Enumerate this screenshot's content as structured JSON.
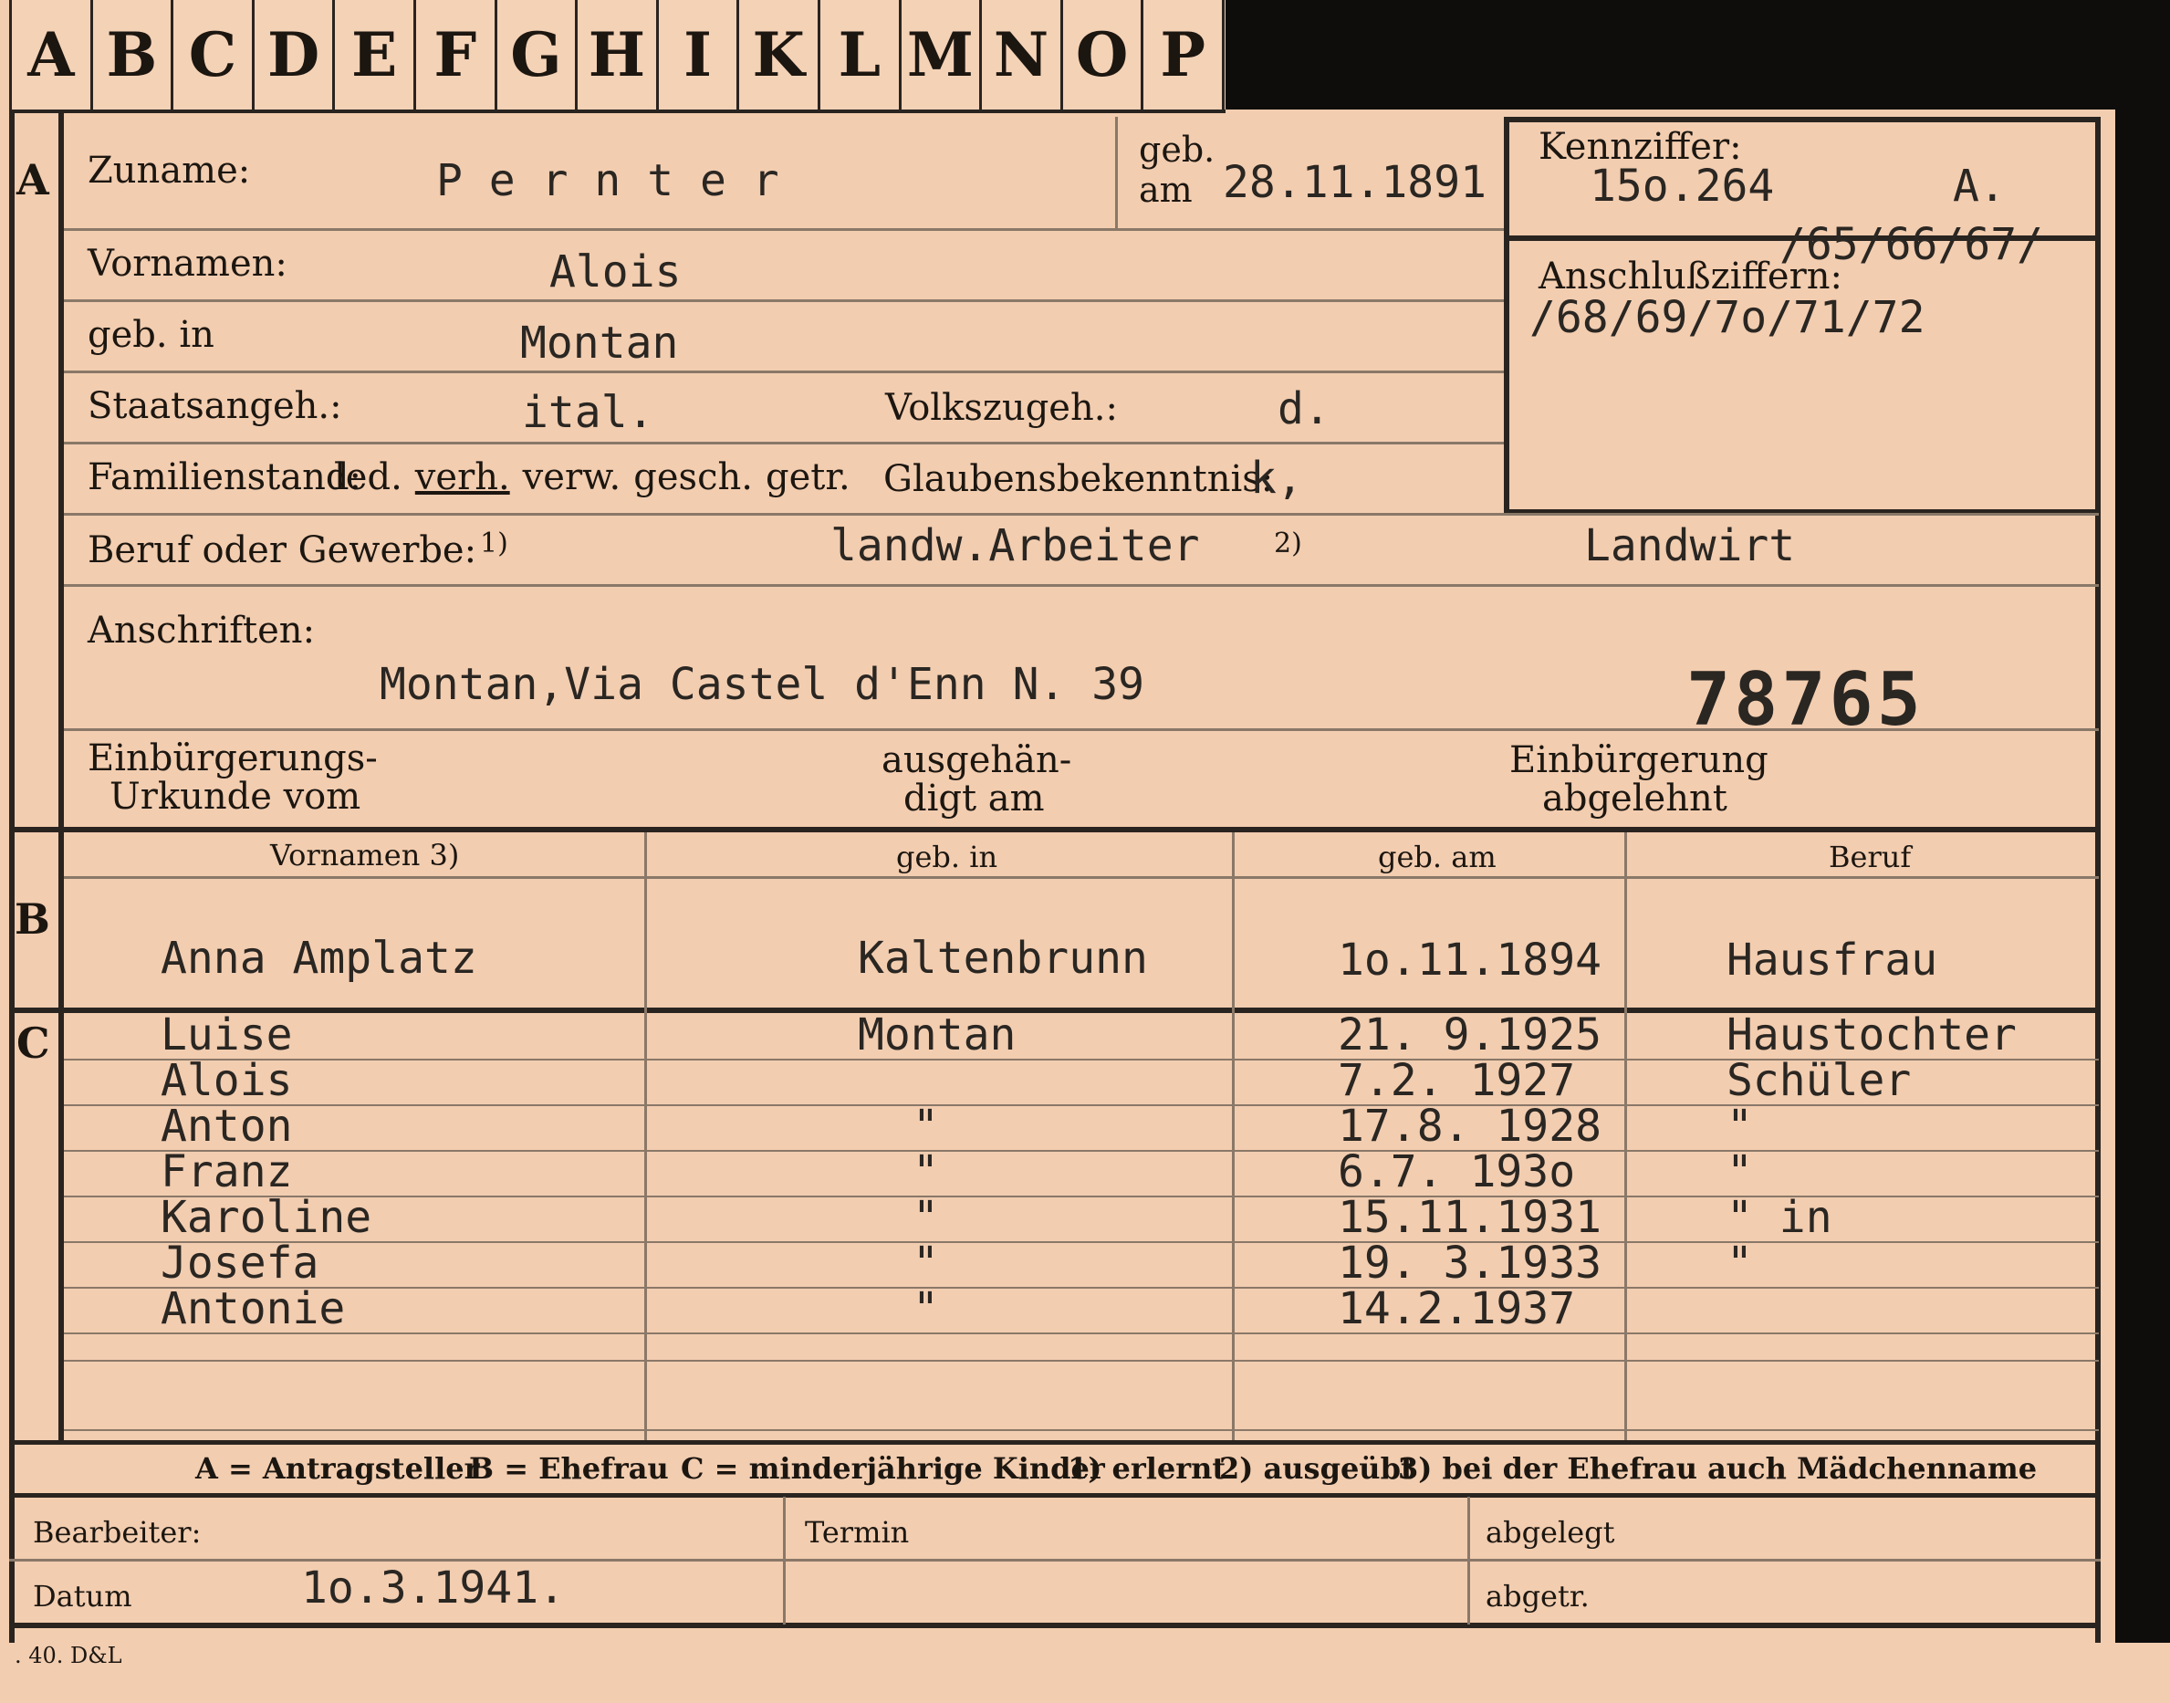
{
  "tabs": [
    "A",
    "B",
    "C",
    "D",
    "E",
    "F",
    "G",
    "H",
    "I",
    "K",
    "L",
    "M",
    "N",
    "O",
    "P"
  ],
  "section_a": {
    "letter": "A",
    "zuname_label": "Zuname:",
    "zuname": "P e r n t e r",
    "geb_label": "geb.",
    "am_label": "am",
    "geb_am": "28.11.1891",
    "kennziffer_label": "Kennziffer:",
    "kennziffer": "15o.264",
    "kennziffer_suffix": "A.",
    "anschluss_label": "Anschlußziffern:",
    "anschluss_line1": "/65/66/67/",
    "anschluss_line2": "/68/69/7o/71/72",
    "vornamen_label": "Vornamen:",
    "vornamen": "Alois",
    "geb_in_label": "geb. in",
    "geb_in": "Montan",
    "staatsangeh_label": "Staatsangeh.:",
    "staatsangeh": "ital.",
    "volkszugeh_label": "Volkszugeh.:",
    "volkszugeh": "d.",
    "familienstand_label": "Familienstand:",
    "familienstand_options": [
      "led.",
      "verh.",
      "verw.",
      "gesch.",
      "getr."
    ],
    "glaubens_label": "Glaubensbekenntnis:",
    "glaubens": "k,",
    "beruf_label": "Beruf oder Gewerbe:",
    "fn1": "1)",
    "beruf_1": "landw.Arbeiter",
    "fn2": "2)",
    "beruf_2": "Landwirt",
    "anschriften_label": "Anschriften:",
    "anschrift": "Montan,Via Castel d'Enn N. 39",
    "stamp_number": "78765",
    "einb_urkunde_label_1": "Einbürgerungs-",
    "einb_urkunde_label_2": "Urkunde vom",
    "ausgehaendigt_label_1": "ausgehän-",
    "ausgehaendigt_label_2": "digt am",
    "einb_abgelehnt_label_1": "Einbürgerung",
    "einb_abgelehnt_label_2": "abgelehnt"
  },
  "section_b": {
    "letter": "B",
    "headers": [
      "Vornamen 3)",
      "geb. in",
      "geb. am",
      "Beruf"
    ],
    "row": {
      "name": "Anna Amplatz",
      "geb_in": "Kaltenbrunn",
      "geb_am": "1o.11.1894",
      "beruf": "Hausfrau"
    }
  },
  "section_c": {
    "letter": "C",
    "children": [
      {
        "name": "Luise",
        "geb_in": "Montan",
        "geb_am": "21. 9.1925",
        "beruf": "Haustochter"
      },
      {
        "name": "Alois",
        "geb_in": "",
        "geb_am": "7.2. 1927",
        "beruf": "Schüler"
      },
      {
        "name": "Anton",
        "geb_in": "\"",
        "geb_am": "17.8. 1928",
        "beruf": "\""
      },
      {
        "name": "Franz",
        "geb_in": "\"",
        "geb_am": "6.7. 193o",
        "beruf": "\""
      },
      {
        "name": "Karoline",
        "geb_in": "\"",
        "geb_am": "15.11.1931",
        "beruf": "\" in"
      },
      {
        "name": "Josefa",
        "geb_in": "\"",
        "geb_am": "19. 3.1933",
        "beruf": "\""
      },
      {
        "name": "Antonie",
        "geb_in": "\"",
        "geb_am": "14.2.1937",
        "beruf": ""
      }
    ]
  },
  "legend": {
    "a": "A = Antragsteller",
    "b": "B = Ehefrau",
    "c": "C = minderjährige Kinder",
    "n1": "1) erlernt",
    "n2": "2) ausgeübt",
    "n3": "3) bei der Ehefrau auch Mädchenname"
  },
  "footer": {
    "bearbeiter_label": "Bearbeiter:",
    "datum_label": "Datum",
    "datum": "1o.3.1941.",
    "termin_label": "Termin",
    "abgelegt_label": "abgelegt",
    "abgetr_label": "abgetr."
  },
  "print_mark": ". 40. D&L"
}
